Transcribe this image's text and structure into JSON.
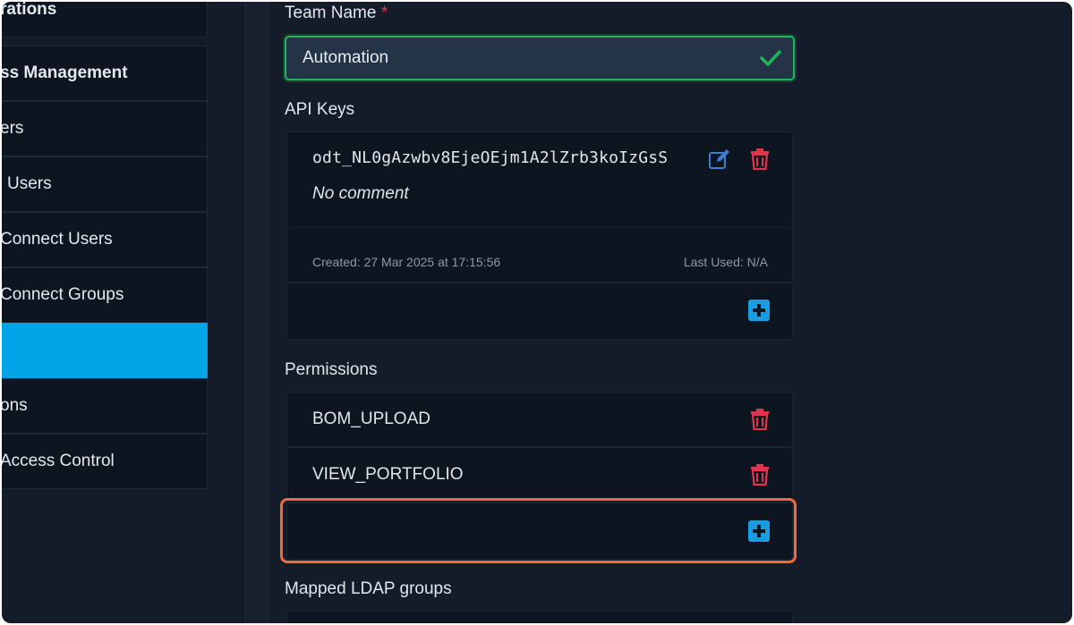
{
  "sidebar": {
    "items": [
      {
        "label": "rations"
      },
      {
        "label": "ss Management"
      },
      {
        "label": "ers"
      },
      {
        "label": "Users"
      },
      {
        "label": "Connect Users"
      },
      {
        "label": "Connect Groups"
      },
      {
        "label": ""
      },
      {
        "label": "ons"
      },
      {
        "label": "Access Control"
      }
    ]
  },
  "team": {
    "label": "Team Name",
    "required_mark": "*",
    "value": "Automation"
  },
  "api_keys": {
    "label": "API Keys",
    "key": "odt_NL0gAzwbv8EjeOEjm1A2lZrb3koIzGsS",
    "comment": "No comment",
    "created": "Created: 27 Mar 2025 at 17:15:56",
    "last_used": "Last Used: N/A"
  },
  "permissions": {
    "label": "Permissions",
    "items": [
      "BOM_UPLOAD",
      "VIEW_PORTFOLIO"
    ]
  },
  "ldap": {
    "label": "Mapped LDAP groups"
  },
  "colors": {
    "accent": "#00a5e6",
    "valid": "#1fb45f",
    "danger": "#e0344b",
    "highlight": "#f26a3a"
  }
}
